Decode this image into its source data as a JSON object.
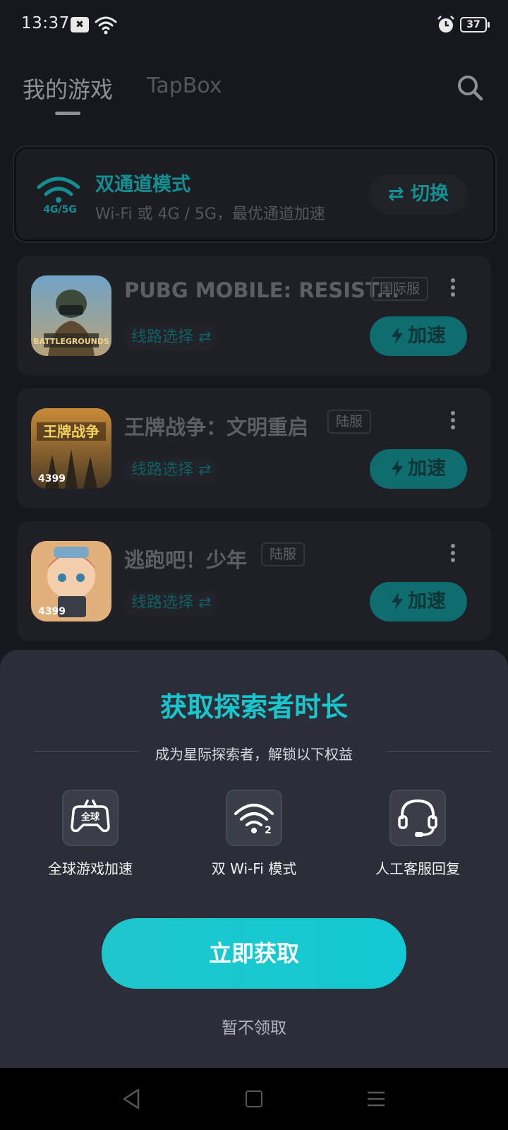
{
  "status_bar": {
    "time": "13:37",
    "notification_glyph": "✖",
    "battery": "37"
  },
  "header": {
    "tabs": [
      "我的游戏",
      "TapBox"
    ],
    "active_tab": "我的游戏"
  },
  "mode_card": {
    "network_label": "4G/5G",
    "title": "双通道模式",
    "description": "Wi-Fi 或 4G / 5G，最优通道加速",
    "switch_label": "切换",
    "switch_glyph": "⇄"
  },
  "games": [
    {
      "name": "PUBG MOBILE: RESIST...",
      "server": "国际服",
      "icon_tag": "",
      "route_label": "线路选择 ⇄",
      "boost_label": "加速"
    },
    {
      "name": "王牌战争：文明重启",
      "server": "陆服",
      "icon_tag": "4399",
      "route_label": "线路选择 ⇄",
      "boost_label": "加速"
    },
    {
      "name": "逃跑吧！少年",
      "server": "陆服",
      "icon_tag": "4399",
      "route_label": "线路选择 ⇄",
      "boost_label": "加速"
    }
  ],
  "sheet": {
    "title": "获取探索者时长",
    "subtitle": "成为星际探索者，解锁以下权益",
    "benefits": [
      {
        "label": "全球游戏加速",
        "icon": "gamepad-global-icon",
        "icon_text": "全球"
      },
      {
        "label": "双 Wi-Fi 模式",
        "icon": "dual-wifi-icon",
        "icon_text": "2"
      },
      {
        "label": "人工客服回复",
        "icon": "headset-icon",
        "icon_text": ""
      }
    ],
    "cta_label": "立即获取",
    "decline_label": "暂不领取"
  },
  "colors": {
    "accent": "#17c7cd",
    "accent_dim": "#138f92",
    "background": "#17181d",
    "sheet": "#2b2e38"
  }
}
